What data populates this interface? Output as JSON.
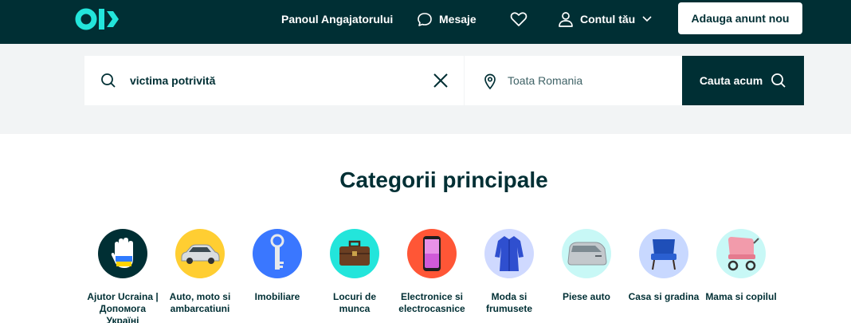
{
  "header": {
    "logo_text": "OLX",
    "nav": {
      "employer_panel": "Panoul Angajatorului",
      "messages": "Mesaje",
      "account": "Contul tău"
    },
    "post_ad_label": "Adauga anunt nou"
  },
  "search": {
    "query_value": "victima potrivită",
    "location_placeholder": "Toata Romania",
    "submit_label": "Cauta acum"
  },
  "categories": {
    "title": "Categorii principale",
    "items": [
      {
        "label": "Ajutor Ucraina | Допомога Україні",
        "icon": "ukraine-hand-icon",
        "color": "#002f34"
      },
      {
        "label": "Auto, moto si ambarcatiuni",
        "icon": "car-icon",
        "color": "#ffce32"
      },
      {
        "label": "Imobiliare",
        "icon": "key-icon",
        "color": "#3a77ff"
      },
      {
        "label": "Locuri de munca",
        "icon": "briefcase-icon",
        "color": "#23e5db"
      },
      {
        "label": "Electronice si electrocasnice",
        "icon": "phone-icon",
        "color": "#ff5636"
      },
      {
        "label": "Moda si frumusete",
        "icon": "dress-icon",
        "color": "#cfd9ff"
      },
      {
        "label": "Piese auto",
        "icon": "car-door-icon",
        "color": "#c8f8f6"
      },
      {
        "label": "Casa si gradina",
        "icon": "chair-icon",
        "color": "#c8d8ff"
      },
      {
        "label": "Mama si copilul",
        "icon": "stroller-icon",
        "color": "#c8f8f6"
      }
    ]
  },
  "colors": {
    "brand_dark": "#002f34",
    "brand_teal": "#23e5db",
    "band_bg": "#f2f4f5"
  }
}
